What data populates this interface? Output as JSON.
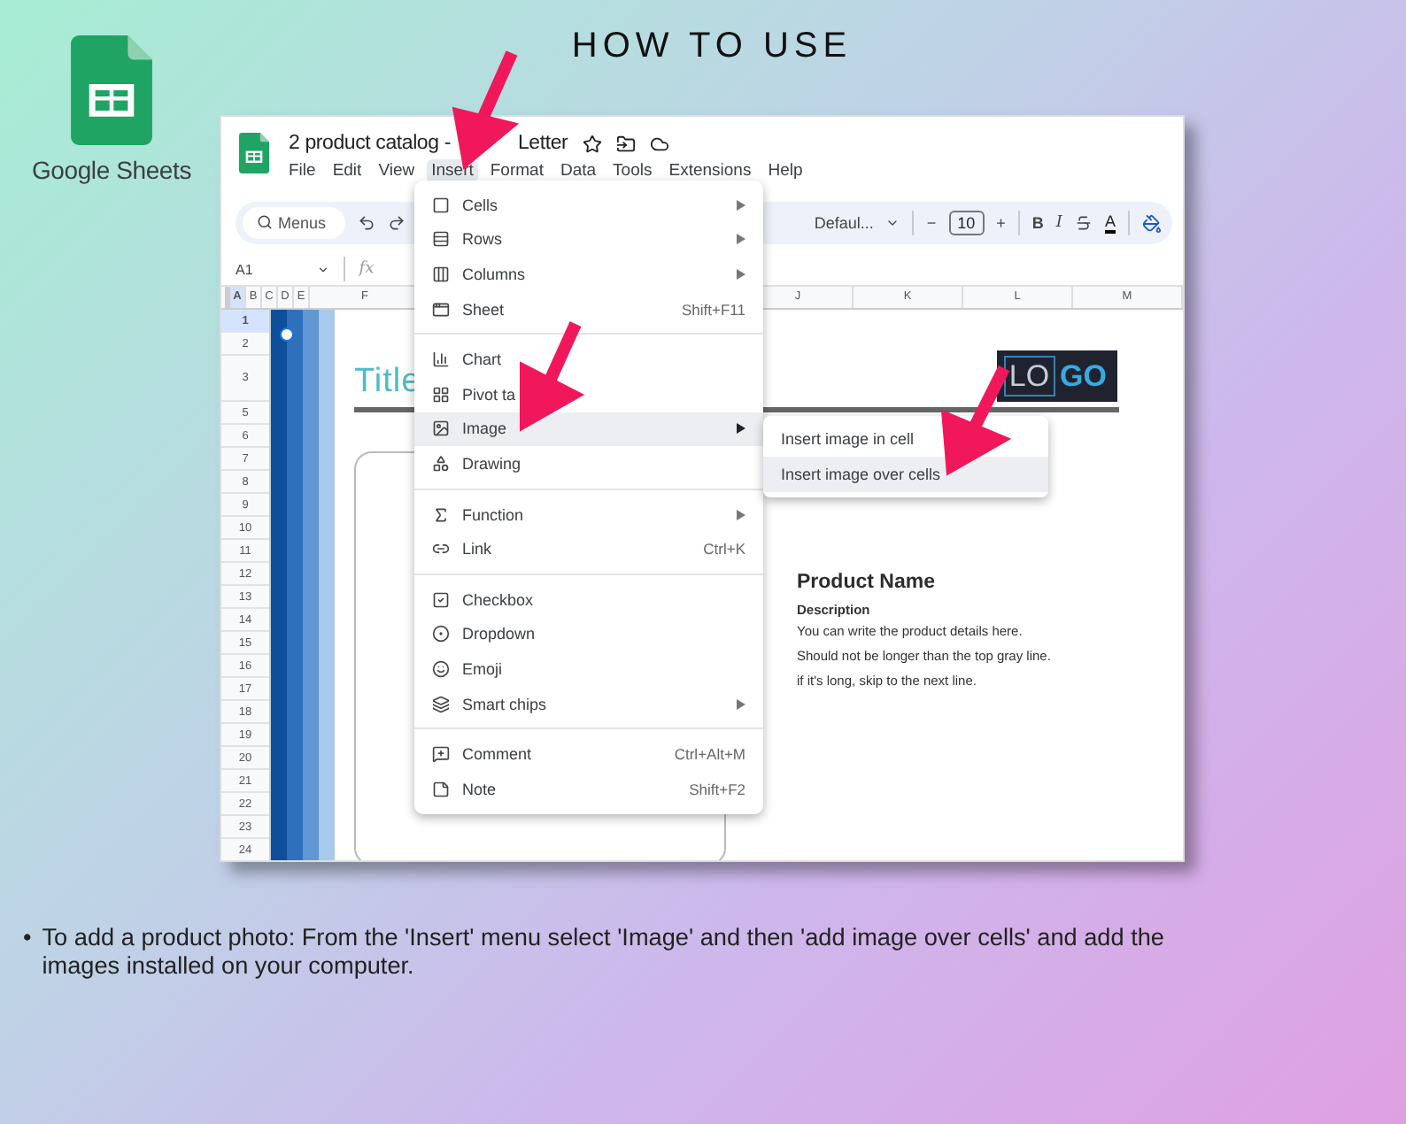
{
  "heading": "HOW TO USE",
  "brand": {
    "name": "Google Sheets"
  },
  "window": {
    "title_parts": [
      "2 product catalog -",
      "Letter"
    ]
  },
  "menu_bar": [
    {
      "label": "File",
      "selected": false
    },
    {
      "label": "Edit",
      "selected": false
    },
    {
      "label": "View",
      "selected": false
    },
    {
      "label": "Insert",
      "selected": true
    },
    {
      "label": "Format",
      "selected": false
    },
    {
      "label": "Data",
      "selected": false
    },
    {
      "label": "Tools",
      "selected": false
    },
    {
      "label": "Extensions",
      "selected": false
    },
    {
      "label": "Help",
      "selected": false
    }
  ],
  "toolbar": {
    "search": {
      "placeholder": "Menus"
    },
    "font": "Defaul...",
    "decrease": "−",
    "font_size": "10",
    "increase": "+",
    "bold": "B",
    "italic": "I",
    "text_color": "A"
  },
  "formula_bar": {
    "cell": "A1",
    "fx": "fx"
  },
  "columns": [
    "A",
    "B",
    "C",
    "D",
    "E",
    "F",
    "J",
    "K",
    "L",
    "M"
  ],
  "rows": [
    "1",
    "2",
    "3",
    "5",
    "6",
    "7",
    "8",
    "9",
    "10",
    "11",
    "12",
    "13",
    "14",
    "15",
    "16",
    "17",
    "18",
    "19",
    "20",
    "21",
    "22",
    "23",
    "24"
  ],
  "sheet": {
    "title": "Title",
    "logo": [
      "LO",
      "GO"
    ],
    "product": {
      "name": "Product Name",
      "description_label": "Description",
      "lines": [
        "You can write the product details here.",
        "Should not be longer than the top gray line.",
        "if it's long, skip to the next line."
      ]
    }
  },
  "insert_menu": [
    [
      {
        "label": "Cells",
        "submenu": true,
        "selected": false
      },
      {
        "label": "Rows",
        "submenu": true,
        "selected": false
      },
      {
        "label": "Columns",
        "submenu": true,
        "selected": false
      },
      {
        "label": "Sheet",
        "shortcut": "Shift+F11",
        "submenu": false,
        "selected": false
      }
    ],
    [
      {
        "label": "Chart",
        "submenu": false,
        "selected": false
      },
      {
        "label": "Pivot ta",
        "submenu": false,
        "selected": false
      },
      {
        "label": "Image",
        "submenu": true,
        "selected": true
      },
      {
        "label": "Drawing",
        "submenu": false,
        "selected": false
      }
    ],
    [
      {
        "label": "Function",
        "submenu": true,
        "selected": false
      },
      {
        "label": "Link",
        "shortcut": "Ctrl+K",
        "submenu": false,
        "selected": false
      }
    ],
    [
      {
        "label": "Checkbox",
        "submenu": false,
        "selected": false
      },
      {
        "label": "Dropdown",
        "submenu": false,
        "selected": false
      },
      {
        "label": "Emoji",
        "submenu": false,
        "selected": false
      },
      {
        "label": "Smart chips",
        "submenu": true,
        "selected": false
      }
    ],
    [
      {
        "label": "Comment",
        "shortcut": "Ctrl+Alt+M",
        "submenu": false,
        "selected": false
      },
      {
        "label": "Note",
        "shortcut": "Shift+F2",
        "submenu": false,
        "selected": false
      }
    ]
  ],
  "image_submenu": [
    {
      "label": "Insert image in cell",
      "selected": false
    },
    {
      "label": "Insert image over cells",
      "selected": true
    }
  ],
  "footnote": {
    "bullet": "•",
    "text": "To add a product photo: From the 'Insert' menu select 'Image' and then 'add image over cells' and add the images installed on your computer."
  }
}
